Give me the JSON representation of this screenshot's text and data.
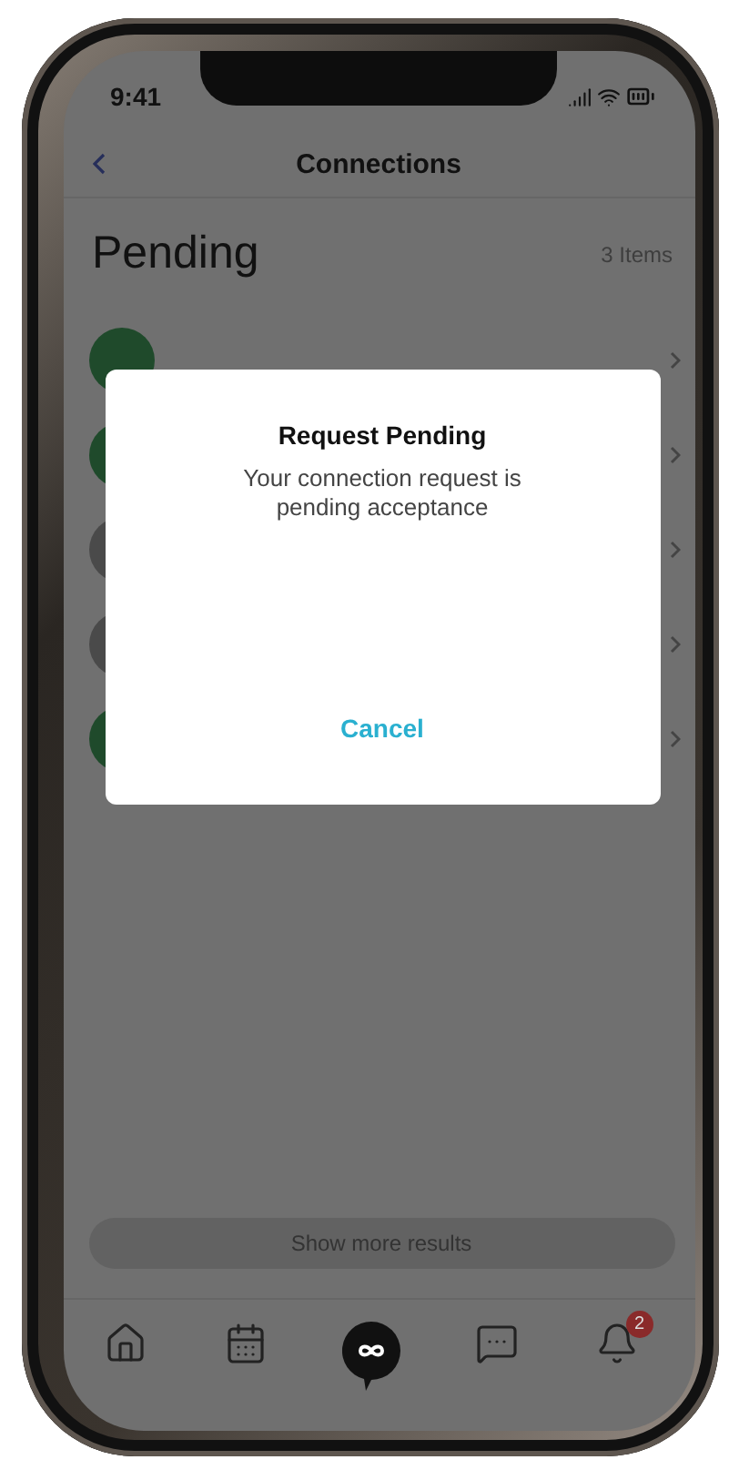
{
  "status_bar": {
    "time": "9:41"
  },
  "nav": {
    "title": "Connections"
  },
  "section": {
    "title": "Pending",
    "count": "3 Items"
  },
  "rows": [
    {
      "color": "#1f4a2b"
    },
    {
      "color": "#1f4a2b"
    },
    {
      "color": "#4a4a4a"
    },
    {
      "color": "#4a4a4a"
    },
    {
      "color": "#1f4a2b"
    }
  ],
  "show_more": {
    "label": "Show more results"
  },
  "tab_bar": {
    "items": [
      {
        "kind": "home"
      },
      {
        "kind": "calendar"
      },
      {
        "kind": "logo"
      },
      {
        "kind": "messages"
      },
      {
        "kind": "notifications",
        "badge": "2"
      }
    ]
  },
  "dialog": {
    "title": "Request Pending",
    "message": "Your connection request is pending acceptance",
    "action": "Cancel"
  }
}
